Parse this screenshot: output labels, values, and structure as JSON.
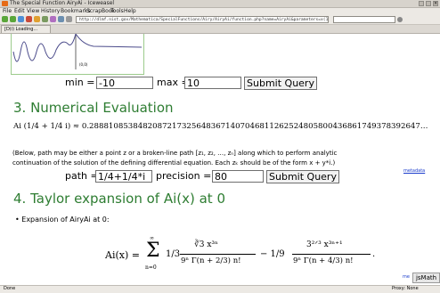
{
  "window": {
    "title": "The Special Function AiryAi - Iceweasel"
  },
  "menu": [
    "File",
    "Edit",
    "View",
    "History",
    "Bookmarks",
    "ScrapBook",
    "Tools",
    "Help"
  ],
  "navigation": {
    "url": "http://dlmf.nist.gov/Mathematica/SpecialFunctions/Airy/AiryAi/function.php?name=AiryAi&parameters=x(1))",
    "search_placeholder": ""
  },
  "tab": {
    "label": "[D(i) Loading..."
  },
  "plot": {
    "axis_label": "(0,0)"
  },
  "range_form": {
    "min_label": "min =",
    "min_value": "-10",
    "max_label": "max =",
    "max_value": "10",
    "submit": "Submit Query"
  },
  "section3": {
    "heading": "3. Numerical Evaluation",
    "expression": "Ai (1/4 + 1/4 i) ≈ 0.28881085384820872173256483671407046811262524805800436861749378392647…",
    "note_line1": "(Below, path may be either a point z or a broken-line path [z₁, z₂, …, zₙ] along which to perform analytic",
    "note_line2": "continuation of the solution of the defining differential equation. Each zₖ should be of the form x + y*i.)",
    "metadata_link": "metadata",
    "path_label": "path =",
    "path_value": "1/4+1/4*i",
    "precision_label": "precision =",
    "precision_value": "80",
    "submit": "Submit Query"
  },
  "section4": {
    "heading": "4. Taylor expansion of Ai(x) at 0",
    "bullet": "Expansion of AiryAi at 0:",
    "formula_lhs": "Ai(x) =",
    "formula_sum": "Σ",
    "sum_top": "∞",
    "sum_bottom": "n=0",
    "term1_coef": "1/3",
    "term1_num": "∛3 x³ⁿ",
    "term1_den": "9ⁿ Γ(n + 2/3) n!",
    "minus": "− 1/9",
    "term2_num": "3²ᐟ³ x³ⁿ⁺¹",
    "term2_den": "9ⁿ Γ(n + 4/3) n!",
    "tail": "."
  },
  "status": {
    "left": "Done",
    "right": "Proxy: None"
  },
  "jsmath": {
    "label": "jsMath",
    "me": "me"
  }
}
